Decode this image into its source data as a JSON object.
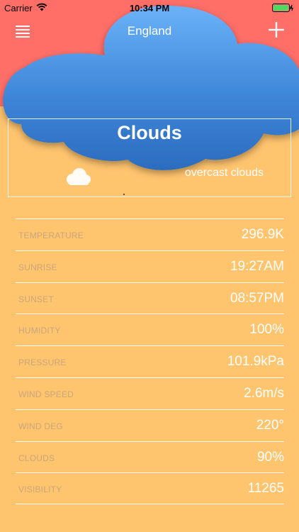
{
  "status_bar": {
    "carrier": "Carrier",
    "time": "10:34 PM"
  },
  "nav": {
    "title": "England"
  },
  "weather": {
    "main": "Clouds",
    "description": "overcast clouds"
  },
  "details": [
    {
      "label": "TEMPERATURE",
      "value": "296.9K"
    },
    {
      "label": "SUNRISE",
      "value": "19:27AM"
    },
    {
      "label": "SUNSET",
      "value": "08:57PM"
    },
    {
      "label": "HUMIDITY",
      "value": "100%"
    },
    {
      "label": "PRESSURE",
      "value": "101.9kPa"
    },
    {
      "label": "WIND SPEED",
      "value": "2.6m/s"
    },
    {
      "label": "WIND DEG",
      "value": "220°"
    },
    {
      "label": "CLOUDS",
      "value": "90%"
    },
    {
      "label": "VISIBILITY",
      "value": "11265"
    }
  ],
  "colors": {
    "top_background": "#FF6F68",
    "bottom_background": "#FFC46E",
    "cloud_top": "#5EA8F2",
    "cloud_bottom": "#2F6FC2",
    "battery": "#4CD964"
  },
  "icons": {
    "menu": "menu-icon",
    "add": "plus-icon",
    "wifi": "wifi-icon",
    "battery": "battery-icon",
    "weather": "cloud-icon"
  }
}
